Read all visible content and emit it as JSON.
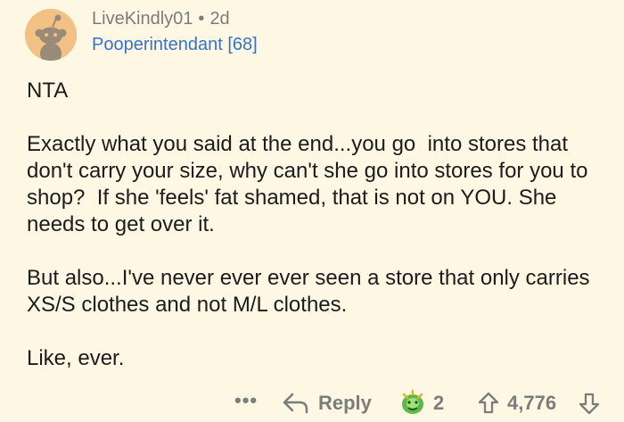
{
  "comment": {
    "username": "LiveKindly01",
    "separator": "•",
    "age": "2d",
    "flair": "Pooperintendant [68]",
    "paragraphs": [
      "NTA",
      "Exactly what you said at the end...you go  into stores that don't carry your size, why can't she go into stores for you to shop?  If she 'feels' fat shamed, that is not on YOU. She needs to get over it.",
      "But also...I've never ever ever seen a store that only carries XS/S clothes and not M/L clothes.",
      "Like, ever."
    ]
  },
  "actions": {
    "more_label": "•••",
    "reply_label": "Reply",
    "award_count": "2",
    "vote_count": "4,776"
  },
  "icons": {
    "avatar": "snoo-avatar-icon",
    "reply": "reply-arrow-icon",
    "award": "award-icon",
    "upvote": "upvote-arrow-icon",
    "downvote": "downvote-arrow-icon"
  },
  "colors": {
    "background": "#fdf7e3",
    "flair": "#3a72c9",
    "meta": "#7c7c7c",
    "avatar_bg": "#f3c185"
  }
}
